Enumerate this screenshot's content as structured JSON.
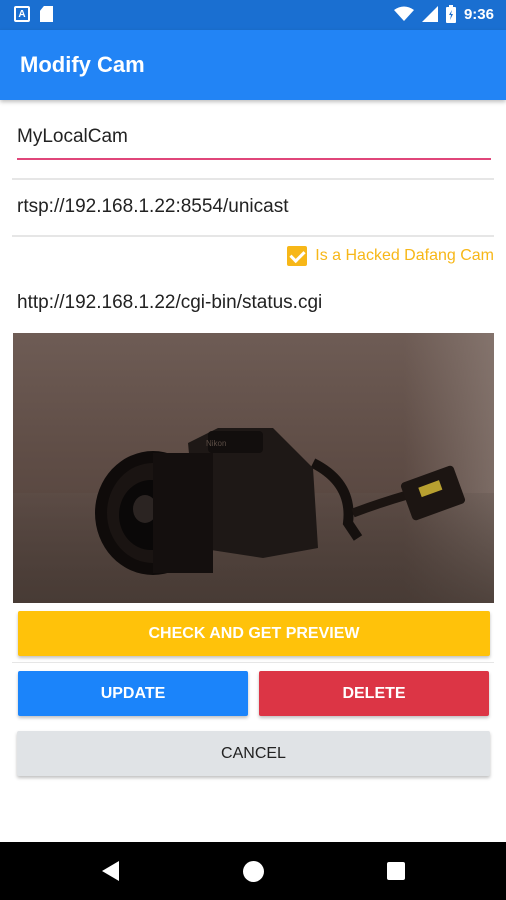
{
  "status_bar": {
    "time": "9:36",
    "icons": [
      "a-notification-icon",
      "sd-card-icon",
      "wifi-icon",
      "signal-icon",
      "battery-icon"
    ]
  },
  "app_bar": {
    "title": "Modify Cam"
  },
  "form": {
    "name_value": "MyLocalCam",
    "rtsp_url": "rtsp://192.168.1.22:8554/unicast",
    "hacked_checkbox_label": "Is a Hacked Dafang Cam",
    "hacked_checked": true,
    "status_url": "http://192.168.1.22/cgi-bin/status.cgi"
  },
  "buttons": {
    "check": "CHECK AND GET PREVIEW",
    "update": "UPDATE",
    "delete": "DELETE",
    "cancel": "CANCEL"
  },
  "colors": {
    "primary": "#2284f5",
    "accent": "#f7b718",
    "danger": "#dc3545",
    "underline": "#e0467a"
  },
  "preview_subject": {
    "logo_text": "Nikon"
  }
}
